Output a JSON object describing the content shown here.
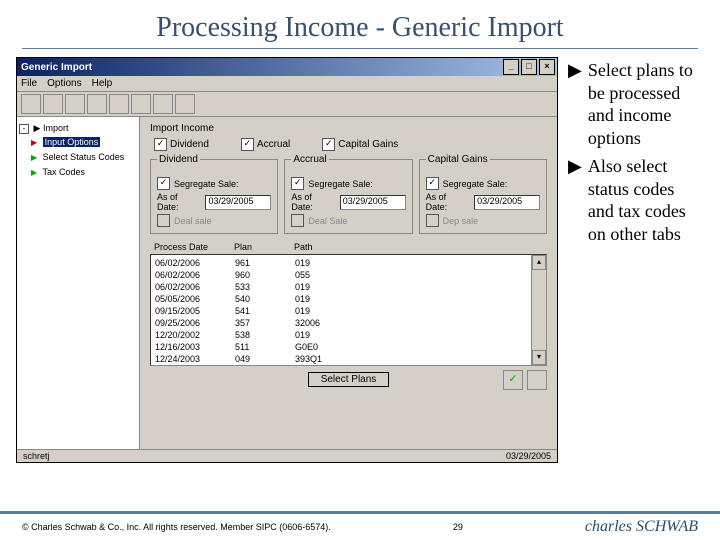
{
  "slide": {
    "title": "Processing Income - Generic Import",
    "page_number": "29",
    "footer_copyright": "© Charles Schwab & Co., Inc.  All rights reserved.  Member SIPC (0606-6574).",
    "logo_prefix": "charles ",
    "logo_suffix": "SCHWAB"
  },
  "bullets": [
    "Select plans to be processed and income options",
    "Also select status codes and tax codes on other tabs"
  ],
  "window": {
    "title": "Generic Import",
    "min": "_",
    "max": "□",
    "close": "×",
    "menus": [
      "File",
      "Options",
      "Help"
    ]
  },
  "tree": {
    "root": "Import",
    "root_tri": "▶",
    "node0": "Input Options",
    "node1": "Select Status Codes",
    "node2": "Tax Codes",
    "tri_green": "▶"
  },
  "panel": {
    "group_label": "Import Income",
    "income_options": [
      {
        "label": "Dividend",
        "checked": true
      },
      {
        "label": "Accrual",
        "checked": true
      },
      {
        "label": "Capital Gains",
        "checked": true
      }
    ],
    "columns": [
      {
        "header": "Dividend",
        "segregate_label": "Segregate Sale:",
        "segregate_checked": true,
        "asof_label": "As of Date:",
        "asof_value": "03/29/2005",
        "deal_label": "Deal sale",
        "deal_checked": false
      },
      {
        "header": "Accrual",
        "segregate_label": "Segregate Sale:",
        "segregate_checked": true,
        "asof_label": "As of Date:",
        "asof_value": "03/29/2005",
        "deal_label": "Deal Sale",
        "deal_checked": false
      },
      {
        "header": "Capital Gains",
        "segregate_label": "Segregate Sale:",
        "segregate_checked": true,
        "asof_label": "As of Date:",
        "asof_value": "03/29/2005",
        "deal_label": "Dep sale",
        "deal_checked": false
      }
    ],
    "list": {
      "headers": [
        "Process Date",
        "Plan",
        "Path"
      ],
      "rows": [
        [
          "06/02/2006",
          "961",
          "019"
        ],
        [
          "06/02/2006",
          "960",
          "055"
        ],
        [
          "06/02/2006",
          "533",
          "019"
        ],
        [
          "05/05/2006",
          "540",
          "019"
        ],
        [
          "09/15/2005",
          "541",
          "019"
        ],
        [
          "09/25/2006",
          "357",
          "32006"
        ],
        [
          "12/20/2002",
          "538",
          "019"
        ],
        [
          "12/16/2003",
          "511",
          "G0E0"
        ],
        [
          "12/24/2003",
          "049",
          "393Q1"
        ]
      ]
    },
    "select_plans_label": "Select Plans"
  },
  "statusbar": {
    "left": "schretj",
    "right": "03/29/2005"
  }
}
